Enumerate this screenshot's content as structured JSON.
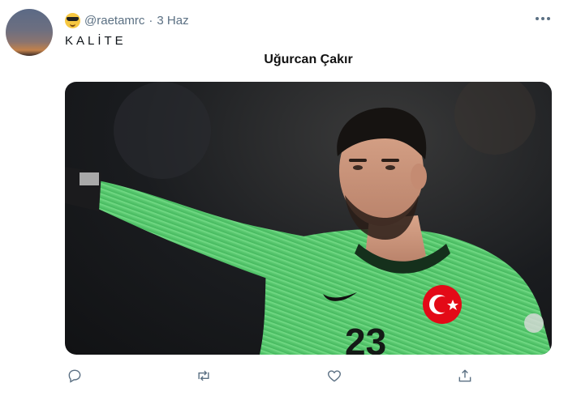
{
  "tweet": {
    "handle": "@raetamrc",
    "separator": "·",
    "date": "3 Haz",
    "text": "KALİTE",
    "emoji": "smiling-face-with-sunglasses-emoji"
  },
  "media": {
    "caption": "Uğurcan Çakır",
    "jersey_number": "23",
    "colors": {
      "jersey": "#5ccf73",
      "flag": "#e30a17",
      "background": "#1a1c1f"
    }
  },
  "actions": {
    "reply": "reply-icon",
    "retweet": "retweet-icon",
    "like": "heart-icon",
    "share": "share-icon"
  }
}
